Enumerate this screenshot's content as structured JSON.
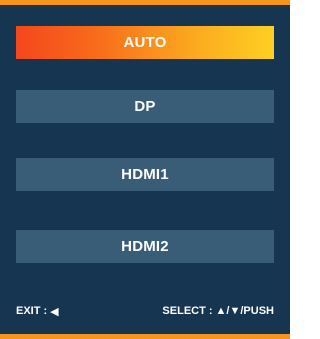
{
  "menu": {
    "options": [
      {
        "label": "AUTO",
        "selected": true
      },
      {
        "label": "DP",
        "selected": false
      },
      {
        "label": "HDMI1",
        "selected": false
      },
      {
        "label": "HDMI2",
        "selected": false
      }
    ]
  },
  "footer": {
    "exit_label": "EXIT :",
    "exit_icon": "◀",
    "select_label": "SELECT :",
    "select_keys": "▲/▼/PUSH"
  },
  "colors": {
    "background": "#163550",
    "border": "#f7941d",
    "option_bg": "#3a5d77",
    "selected_gradient_start": "#f4471c",
    "selected_gradient_end": "#fdd022"
  }
}
